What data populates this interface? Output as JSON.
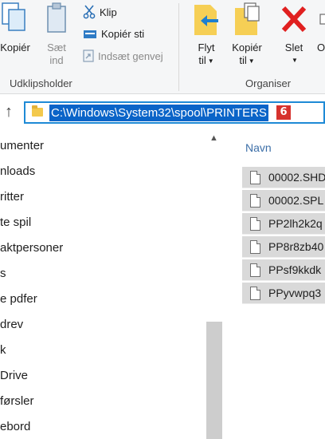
{
  "ribbon": {
    "clipboard": {
      "copy_label": "Kopiér",
      "paste_label_line1": "Sæt",
      "paste_label_line2": "ind",
      "cut_label": "Klip",
      "copy_path_label": "Kopiér sti",
      "paste_shortcut_label": "Indsæt genvej",
      "group_label": "Udklipsholder"
    },
    "organize": {
      "move_label_line1": "Flyt",
      "move_label_line2": "til",
      "copyto_label_line1": "Kopiér",
      "copyto_label_line2": "til",
      "delete_label": "Slet",
      "rename_label_partial": "O",
      "group_label": "Organiser"
    }
  },
  "address": {
    "path": "C:\\Windows\\System32\\spool\\PRINTERS",
    "badge": "6"
  },
  "nav_items": [
    "umenter",
    "nloads",
    "ritter",
    "te spil",
    "aktpersoner",
    "s",
    "e pdfer",
    "drev",
    "k",
    "Drive",
    "førsler",
    "ebord"
  ],
  "files": {
    "column_header": "Navn",
    "items": [
      "00002.SHD",
      "00002.SPL",
      "PP2lh2k2q",
      "PP8r8zb40",
      "PPsf9kkdk",
      "PPyvwpq3"
    ]
  },
  "colors": {
    "accent_blue": "#0a64c8",
    "address_border": "#1e8ad6",
    "delete_red": "#e02020",
    "badge_red": "#d6322e",
    "folder_yellow": "#f3c94c"
  }
}
